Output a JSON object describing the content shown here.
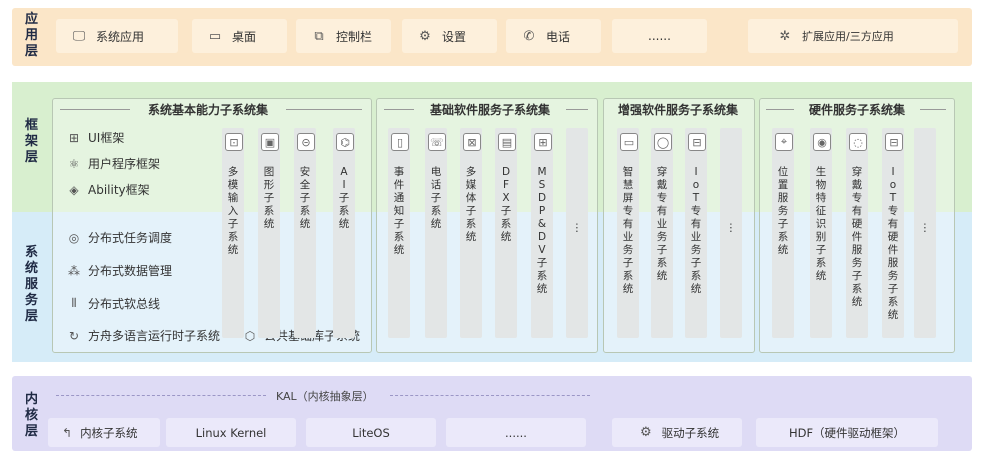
{
  "layers": {
    "app": "应用层",
    "framework": "框架层",
    "service": "系统服务层",
    "kernel": "内核层"
  },
  "app_items": [
    {
      "label": "系统应用",
      "icon": "computer-icon"
    },
    {
      "label": "桌面",
      "icon": "monitor-icon"
    },
    {
      "label": "控制栏",
      "icon": "control-bar-icon"
    },
    {
      "label": "设置",
      "icon": "gear-icon"
    },
    {
      "label": "电话",
      "icon": "phone-icon"
    },
    {
      "label": "......",
      "icon": ""
    },
    {
      "label": "扩展应用/三方应用",
      "icon": "puzzle-icon"
    }
  ],
  "basic_capability": {
    "title": "系统基本能力子系统集",
    "framework_items": [
      {
        "label": "UI框架",
        "icon": "ui-frame-icon"
      },
      {
        "label": "用户程序框架",
        "icon": "app-framework-icon"
      },
      {
        "label": "Ability框架",
        "icon": "ability-icon"
      }
    ],
    "service_items": [
      {
        "label": "分布式任务调度",
        "icon": "task-schedule-icon"
      },
      {
        "label": "分布式数据管理",
        "icon": "data-management-icon"
      },
      {
        "label": "分布式软总线",
        "icon": "softbus-icon"
      },
      {
        "label": "方舟多语言运行时子系统",
        "icon": "ark-runtime-icon"
      },
      {
        "label": "公共基础库子系统",
        "icon": "common-lib-icon"
      }
    ],
    "columns": [
      {
        "label": "多模输入子系统",
        "icon": "input-icon"
      },
      {
        "label": "图形子系统",
        "icon": "graphics-icon"
      },
      {
        "label": "安全子系统",
        "icon": "security-icon"
      },
      {
        "label": "AI子系统",
        "icon": "ai-icon"
      }
    ]
  },
  "basic_software": {
    "title": "基础软件服务子系统集",
    "columns": [
      {
        "label": "事件通知子系统",
        "icon": "notification-icon"
      },
      {
        "label": "电话子系统",
        "icon": "telephony-icon"
      },
      {
        "label": "多媒体子系统",
        "icon": "multimedia-icon"
      },
      {
        "label": "DFX子系统",
        "icon": "dfx-icon"
      },
      {
        "label": "MSDP&DV子系统",
        "icon": "msdp-icon"
      },
      {
        "label": "⋮",
        "icon": ""
      }
    ]
  },
  "enhanced_software": {
    "title": "增强软件服务子系统集",
    "columns": [
      {
        "label": "智慧屏专有业务子系统",
        "icon": "smart-screen-icon"
      },
      {
        "label": "穿戴专有业务子系统",
        "icon": "wearable-icon"
      },
      {
        "label": "IoT专有业务子系统",
        "icon": "iot-icon"
      },
      {
        "label": "⋮",
        "icon": ""
      }
    ]
  },
  "hardware": {
    "title": "硬件服务子系统集",
    "columns": [
      {
        "label": "位置服务子系统",
        "icon": "location-icon"
      },
      {
        "label": "生物特征识别子系统",
        "icon": "biometric-icon"
      },
      {
        "label": "穿戴专有硬件服务子系统",
        "icon": "wearable-hw-icon"
      },
      {
        "label": "IoT专有硬件服务子系统",
        "icon": "iot-hw-icon"
      },
      {
        "label": "⋮",
        "icon": ""
      }
    ]
  },
  "kernel": {
    "kal": "KAL（内核抽象层）",
    "subsystem": "内核子系统",
    "items": [
      "Linux Kernel",
      "LiteOS",
      "......"
    ],
    "driver": "驱动子系统",
    "hdf": "HDF（硬件驱动框架）"
  },
  "colors": {
    "app_band": "#fbe6c8",
    "framework_band": "#d8efcf",
    "service_band": "#d6ecf8",
    "kernel_band": "#dedbf5",
    "column": "#e3e6e6"
  }
}
